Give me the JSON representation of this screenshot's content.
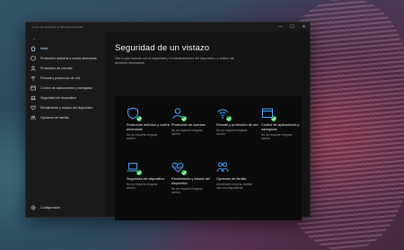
{
  "window": {
    "title": "Centro de seguridad de Windows Defender",
    "controls": [
      "—",
      "☐",
      "✕"
    ]
  },
  "sidebar": {
    "back_label": "←",
    "items": [
      {
        "label": "Inicio",
        "icon": "home-icon",
        "active": true
      },
      {
        "label": "Protección antivirus y contra amenazas",
        "icon": "shield-icon"
      },
      {
        "label": "Protección de cuentas",
        "icon": "person-icon"
      },
      {
        "label": "Firewall y protección de red",
        "icon": "wifi-icon"
      },
      {
        "label": "Control de aplicaciones y navegador",
        "icon": "browser-icon"
      },
      {
        "label": "Seguridad del dispositivo",
        "icon": "laptop-icon"
      },
      {
        "label": "Rendimiento y estado del dispositivo",
        "icon": "heart-icon"
      },
      {
        "label": "Opciones de familia",
        "icon": "family-icon"
      }
    ],
    "settings_label": "Configuración"
  },
  "main": {
    "title": "Seguridad de un vistazo",
    "description": "Vea lo que sucede con la seguridad y el mantenimiento del dispositivo, y realice las acciones necesarias."
  },
  "tiles": [
    {
      "name": "Protección antivirus y contra amenazas",
      "status": "No se requiere ninguna acción.",
      "icon": "shield-icon"
    },
    {
      "name": "Protección de cuentas",
      "status": "No se requiere ninguna acción.",
      "icon": "person-icon"
    },
    {
      "name": "Firewall y protección de red",
      "status": "No se requiere ninguna acción.",
      "icon": "wifi-icon"
    },
    {
      "name": "Control de aplicaciones y navegador",
      "status": "No se requiere ninguna acción.",
      "icon": "browser-icon"
    },
    {
      "name": "Seguridad del dispositivo",
      "status": "No se requiere ninguna acción.",
      "icon": "laptop-icon"
    },
    {
      "name": "Rendimiento y estado del dispositivo",
      "status": "No se requiere ninguna acción.",
      "icon": "heart-icon"
    },
    {
      "name": "Opciones de familia",
      "status": "Administre cómo su familia usa sus dispositivos.",
      "icon": "family-icon"
    }
  ],
  "colors": {
    "accent": "#4aa3ff",
    "ok_badge": "#27c24b",
    "window_bg": "#141414",
    "tile_area_bg": "#0b0b0b"
  }
}
